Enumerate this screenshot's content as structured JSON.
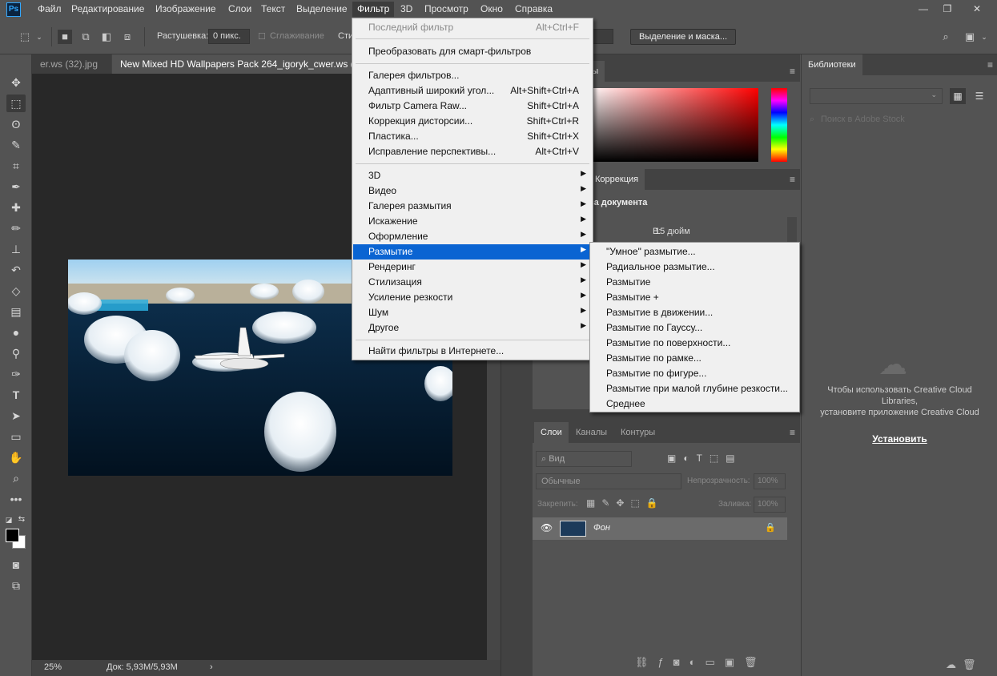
{
  "app": {
    "logo": "Ps"
  },
  "menubar": {
    "items": [
      "Файл",
      "Редактирование",
      "Изображение",
      "Слои",
      "Текст",
      "Выделение",
      "Фильтр",
      "3D",
      "Просмотр",
      "Окно",
      "Справка"
    ],
    "active": "Фильтр"
  },
  "window_controls": {
    "minimize": "—",
    "restore": "❐",
    "close": "✕"
  },
  "options": {
    "feather_label": "Растушевка:",
    "feather_value": "0 пикс.",
    "antialias_label": "Сглаживание",
    "style_label": "Сти",
    "select_mask_button": "Выделение и маска..."
  },
  "tabs": {
    "inactive": "er.ws (32).jpg",
    "active": "New Mixed HD Wallpapers Pack 264_igoryk_cwer.ws (89"
  },
  "status": {
    "zoom": "25%",
    "doc": "Док: 5,93M/5,93M",
    "arrow": "›"
  },
  "filter_menu": {
    "items": [
      {
        "label": "Последний фильтр",
        "shortcut": "Alt+Ctrl+F",
        "disabled": true
      },
      {
        "label": "Преобразовать для смарт-фильтров",
        "shortcut": ""
      },
      {
        "label": "Галерея фильтров...",
        "shortcut": ""
      },
      {
        "label": "Адаптивный широкий угол...",
        "shortcut": "Alt+Shift+Ctrl+A"
      },
      {
        "label": "Фильтр Camera Raw...",
        "shortcut": "Shift+Ctrl+A"
      },
      {
        "label": "Коррекция дисторсии...",
        "shortcut": "Shift+Ctrl+R"
      },
      {
        "label": "Пластика...",
        "shortcut": "Shift+Ctrl+X"
      },
      {
        "label": "Исправление перспективы...",
        "shortcut": "Alt+Ctrl+V"
      },
      {
        "label": "3D",
        "submenu": true
      },
      {
        "label": "Видео",
        "submenu": true
      },
      {
        "label": "Галерея размытия",
        "submenu": true
      },
      {
        "label": "Искажение",
        "submenu": true
      },
      {
        "label": "Оформление",
        "submenu": true
      },
      {
        "label": "Размытие",
        "submenu": true,
        "highlighted": true
      },
      {
        "label": "Рендеринг",
        "submenu": true
      },
      {
        "label": "Стилизация",
        "submenu": true
      },
      {
        "label": "Усиление резкости",
        "submenu": true
      },
      {
        "label": "Шум",
        "submenu": true
      },
      {
        "label": "Другое",
        "submenu": true
      },
      {
        "label": "Найти фильтры в Интернете...",
        "shortcut": ""
      }
    ],
    "arrow": "▶"
  },
  "blur_submenu": {
    "items": [
      "\"Умное\" размытие...",
      "Радиальное размытие...",
      "Размытие",
      "Размытие +",
      "Размытие в движении...",
      "Размытие по Гауссу...",
      "Размытие по поверхности...",
      "Размытие по рамке...",
      "Размытие по фигуре...",
      "Размытие при малой глубине резкости...",
      "Среднее"
    ]
  },
  "color_panel": {
    "tab_partial": "цы"
  },
  "properties_panel": {
    "tab_partial": "Коррекция",
    "heading_partial": "ва документа",
    "height_label": "В:",
    "height_value": "15 дюйм"
  },
  "layers_panel": {
    "tabs": [
      "Слои",
      "Каналы",
      "Контуры"
    ],
    "kind_placeholder": "Вид",
    "blend_mode": "Обычные",
    "opacity_label": "Непрозрачность:",
    "opacity_value": "100%",
    "lock_label": "Закрепить:",
    "fill_label": "Заливка:",
    "fill_value": "100%",
    "layer_name": "Фон"
  },
  "libraries_panel": {
    "tab": "Библиотеки",
    "search_placeholder": "Поиск в Adobe Stock",
    "message_line1": "Чтобы использовать Creative Cloud",
    "message_line2": "Libraries,",
    "message_line3": "установите приложение Creative Cloud",
    "install_link": "Установить"
  },
  "colors": {
    "menu_highlight": "#0a64d2",
    "panel_bg": "#535353",
    "canvas_bg": "#282828"
  }
}
